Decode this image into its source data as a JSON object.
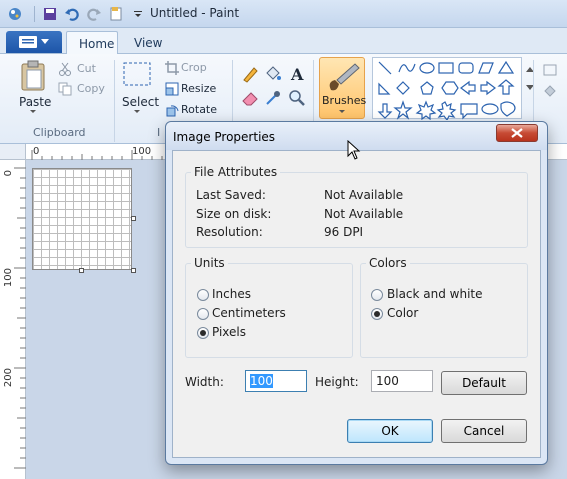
{
  "window": {
    "title": "Untitled - Paint"
  },
  "ribbon": {
    "tabs": [
      "Home",
      "View"
    ],
    "clipboard": {
      "paste": "Paste",
      "cut": "Cut",
      "copy": "Copy",
      "group_label": "Clipboard"
    },
    "image": {
      "select": "Select",
      "crop": "Crop",
      "resize": "Resize",
      "rotate": "Rotate",
      "group_label_partial": "I"
    },
    "tools": {
      "brushes": "Brushes"
    }
  },
  "rulers": {
    "horizontal": [
      "0",
      "100"
    ],
    "vertical": [
      "0",
      "100",
      "200"
    ]
  },
  "dialog": {
    "title": "Image Properties",
    "file_attributes": {
      "legend": "File Attributes",
      "rows": [
        {
          "label": "Last Saved:",
          "value": "Not Available"
        },
        {
          "label": "Size on disk:",
          "value": "Not Available"
        },
        {
          "label": "Resolution:",
          "value": "96 DPI"
        }
      ]
    },
    "units": {
      "legend": "Units",
      "options": [
        "Inches",
        "Centimeters",
        "Pixels"
      ],
      "selected": "Pixels"
    },
    "colors": {
      "legend": "Colors",
      "options": [
        "Black and white",
        "Color"
      ],
      "selected": "Color"
    },
    "width_label": "Width:",
    "width_value": "100",
    "height_label": "Height:",
    "height_value": "100",
    "default_button": "Default",
    "ok_button": "OK",
    "cancel_button": "Cancel"
  },
  "colors": {
    "accent": "#3c7fb1",
    "close_button": "#c74a34"
  }
}
